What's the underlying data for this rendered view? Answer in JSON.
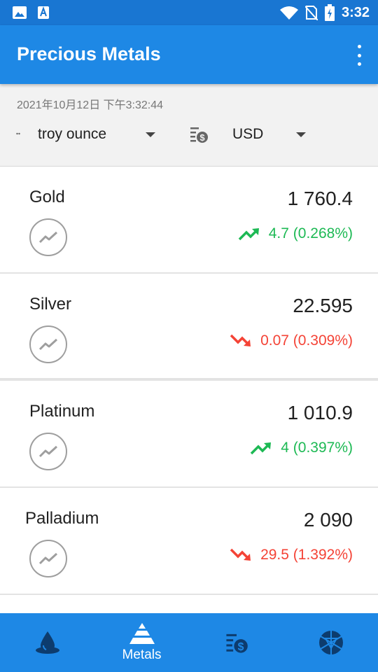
{
  "status_bar": {
    "time": "3:32",
    "icons": [
      "image-icon",
      "font-icon",
      "wifi-icon",
      "no-sim-icon",
      "battery-charging-icon"
    ]
  },
  "app_bar": {
    "title": "Precious Metals",
    "overflow_icon": "more-vert-icon"
  },
  "filters": {
    "timestamp": "2021年10月12日 下午3:32:44",
    "unit": "troy ounce",
    "unit_icon": "weight-icon",
    "currency": "USD",
    "currency_icon": "currency-list-icon"
  },
  "metals": [
    {
      "name": "Gold",
      "price": "1 760.4",
      "change": "4.7 (0.268%)",
      "direction": "up"
    },
    {
      "name": "Silver",
      "price": "22.595",
      "change": "0.07 (0.309%)",
      "direction": "down"
    },
    {
      "name": "Platinum",
      "price": "1 010.9",
      "change": "4 (0.397%)",
      "direction": "up"
    },
    {
      "name": "Palladium",
      "price": "2 090",
      "change": "29.5 (1.392%)",
      "direction": "down"
    }
  ],
  "bottom_nav": {
    "items": [
      {
        "label": "",
        "icon": "drop-icon",
        "active": false
      },
      {
        "label": "Metals",
        "icon": "pyramid-icon",
        "active": true
      },
      {
        "label": "",
        "icon": "currency-list-icon",
        "active": false
      },
      {
        "label": "",
        "icon": "gem-icon",
        "active": false
      }
    ]
  },
  "colors": {
    "primary": "#1e88e5",
    "primary_dark": "#1976d2",
    "up": "#1db954",
    "down": "#f44336"
  }
}
